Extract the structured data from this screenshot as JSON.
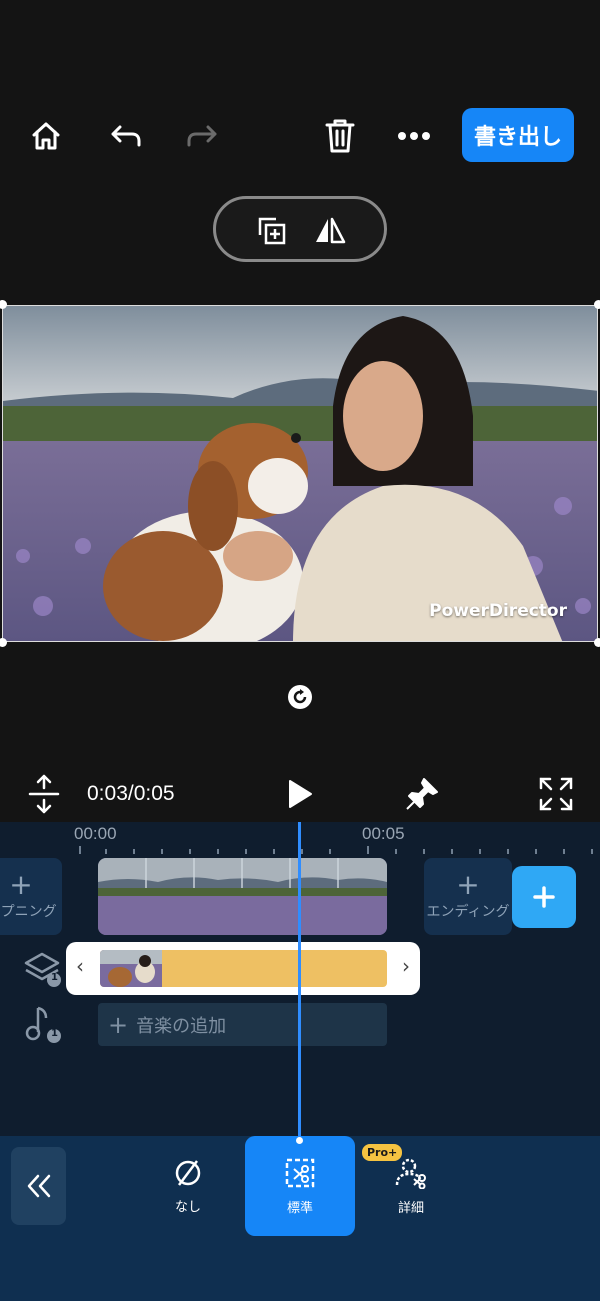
{
  "toolbar": {
    "home_icon": "home-icon",
    "undo_icon": "undo-icon",
    "redo_icon": "redo-icon",
    "delete_icon": "trash-icon",
    "more_icon": "more-dots-icon",
    "export_label": "書き出し",
    "accent": "#1686f7"
  },
  "preview": {
    "watermark": "PowerDirector"
  },
  "playback": {
    "time": "0:03/0:05"
  },
  "timeline": {
    "ruler_start": "00:00",
    "ruler_mid": "00:05",
    "opening_label": "オープニング",
    "ending_label": "エンディング",
    "overlay_count": "1",
    "music_count": "1",
    "add_music_label": "音楽の追加"
  },
  "bottom": {
    "options": [
      {
        "label": "なし",
        "icon": "none-icon"
      },
      {
        "label": "標準",
        "icon": "cutout-standard-icon",
        "selected": true
      },
      {
        "label": "詳細",
        "icon": "cutout-detail-icon"
      }
    ],
    "pro_badge": "Pro+"
  }
}
